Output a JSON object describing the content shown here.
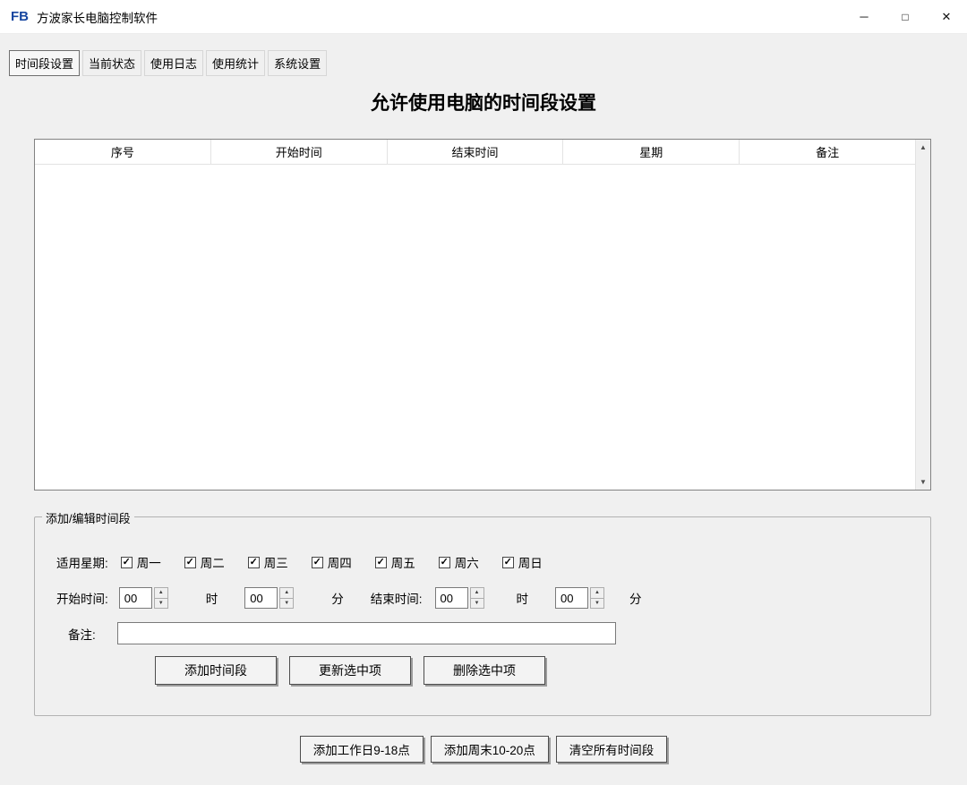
{
  "window": {
    "logo": "FB",
    "title": "方波家长电脑控制软件"
  },
  "icons": {
    "minimize": "─",
    "maximize": "□",
    "close": "✕",
    "check": "✓",
    "spin_up": "▲",
    "spin_down": "▼",
    "scroll_up": "▲",
    "scroll_down": "▼"
  },
  "tabs": [
    {
      "label": "时间段设置",
      "active": true
    },
    {
      "label": "当前状态",
      "active": false
    },
    {
      "label": "使用日志",
      "active": false
    },
    {
      "label": "使用统计",
      "active": false
    },
    {
      "label": "系统设置",
      "active": false
    }
  ],
  "main": {
    "heading": "允许使用电脑的时间段设置",
    "table": {
      "headers": [
        "序号",
        "开始时间",
        "结束时间",
        "星期",
        "备注"
      ],
      "rows": []
    }
  },
  "editor": {
    "group_title": "添加/编辑时间段",
    "weekday_label": "适用星期:",
    "weekdays": [
      {
        "label": "周一",
        "checked": true
      },
      {
        "label": "周二",
        "checked": true
      },
      {
        "label": "周三",
        "checked": true
      },
      {
        "label": "周四",
        "checked": true
      },
      {
        "label": "周五",
        "checked": true
      },
      {
        "label": "周六",
        "checked": true
      },
      {
        "label": "周日",
        "checked": true
      }
    ],
    "start_label": "开始时间:",
    "end_label": "结束时间:",
    "hour_unit": "时",
    "minute_unit": "分",
    "start_hour": "00",
    "start_minute": "00",
    "end_hour": "00",
    "end_minute": "00",
    "note_label": "备注:",
    "note_value": "",
    "buttons": {
      "add": "添加时间段",
      "update": "更新选中项",
      "delete": "删除选中项"
    }
  },
  "footer_buttons": [
    {
      "label": "添加工作日9-18点"
    },
    {
      "label": "添加周末10-20点"
    },
    {
      "label": "清空所有时间段"
    }
  ]
}
